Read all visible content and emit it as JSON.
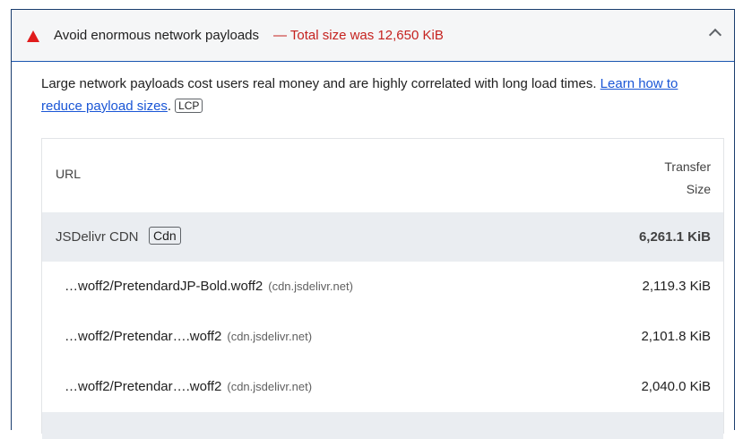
{
  "audit": {
    "title": "Avoid enormous network payloads",
    "display_value": "— Total size was 12,650 KiB",
    "status_color": "#e01c1c",
    "icon": "fail-triangle-icon",
    "description_text": "Large network payloads cost users real money and are highly correlated with long load times. ",
    "learn_more_label": "Learn how to reduce payload sizes",
    "badge": "LCP"
  },
  "table": {
    "headers": {
      "url": "URL",
      "size_line1": "Transfer",
      "size_line2": "Size"
    },
    "group": {
      "name": "JSDelivr CDN",
      "badge": "Cdn",
      "size": "6,261.1 KiB"
    },
    "rows": [
      {
        "url": "…woff2/PretendardJP-Bold.woff2",
        "host": "(cdn.jsdelivr.net)",
        "size": "2,119.3 KiB"
      },
      {
        "url": "…woff2/Pretendar….woff2",
        "host": "(cdn.jsdelivr.net)",
        "size": "2,101.8 KiB"
      },
      {
        "url": "…woff2/Pretendar….woff2",
        "host": "(cdn.jsdelivr.net)",
        "size": "2,040.0 KiB"
      }
    ]
  }
}
